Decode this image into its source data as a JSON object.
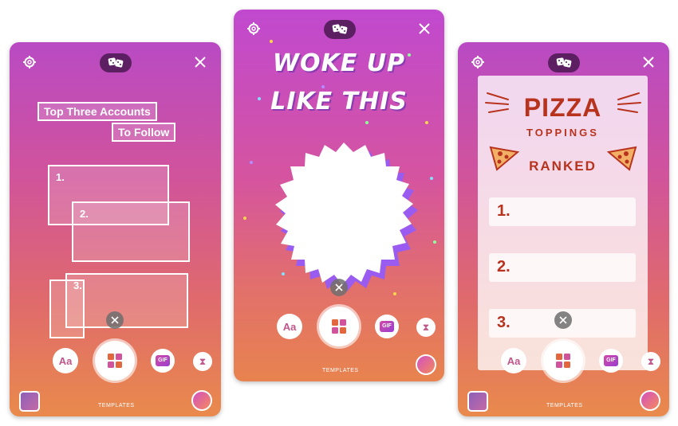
{
  "templates_label": "TEMPLATES",
  "tools": {
    "text": "Aa",
    "gif": "GIF",
    "timer": "⧗"
  },
  "icons": [
    "gear-icon",
    "dice-icon",
    "close-icon",
    "text-tool-icon",
    "templates-icon",
    "gif-icon",
    "timer-icon",
    "remove-icon"
  ],
  "screen1": {
    "title_line1": "Top Three Accounts",
    "title_line2": "To Follow",
    "slots": [
      "1.",
      "2.",
      "3."
    ]
  },
  "screen2": {
    "title_line1": "WOKE UP",
    "title_line2": "LIKE THIS"
  },
  "screen3": {
    "title_main": "PIZZA",
    "title_sub": "TOPPINGS",
    "title_rank": "RANKED",
    "slots": [
      "1.",
      "2.",
      "3."
    ]
  },
  "colors": {
    "accent_purple": "#b94ac4",
    "accent_orange": "#e98a4c",
    "pizza_red": "#b8331e"
  }
}
